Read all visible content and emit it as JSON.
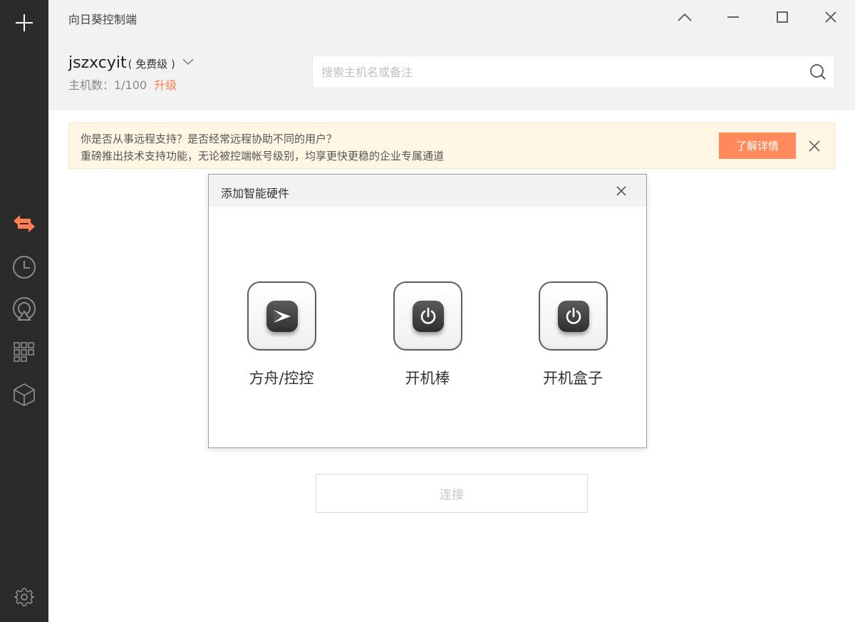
{
  "app": {
    "title": "向日葵控制端"
  },
  "account": {
    "name": "jszxcyit",
    "tier": "( 免费级 )",
    "host_count_label": "主机数：1/100",
    "upgrade_label": "升级"
  },
  "search": {
    "placeholder": "搜索主机名或备注"
  },
  "banner": {
    "line1": "你是否从事远程支持？是否经常远程协助不同的用户？",
    "line2": "重磅推出技术支持功能，无论被控端帐号级别，均享更快更稳的企业专属通道",
    "button_label": "了解详情"
  },
  "sidebar": {
    "items": [
      {
        "icon": "plus-icon"
      },
      {
        "icon": "remote-control-arrows-icon",
        "active": true
      },
      {
        "icon": "clock-icon"
      },
      {
        "icon": "discovery-icon"
      },
      {
        "icon": "grid-icon"
      },
      {
        "icon": "cube-icon"
      },
      {
        "icon": "gear-icon"
      }
    ]
  },
  "dialog": {
    "title": "添加智能硬件",
    "devices": [
      {
        "label": "方舟/控控",
        "icon": "play-arrow-icon"
      },
      {
        "label": "开机棒",
        "icon": "power-icon"
      },
      {
        "label": "开机盒子",
        "icon": "power-icon"
      }
    ]
  },
  "connect": {
    "label": "连接"
  },
  "colors": {
    "accent": "#ff7f50",
    "sidebar_bg": "#2b2b2b",
    "banner_bg": "#fff7e3"
  }
}
